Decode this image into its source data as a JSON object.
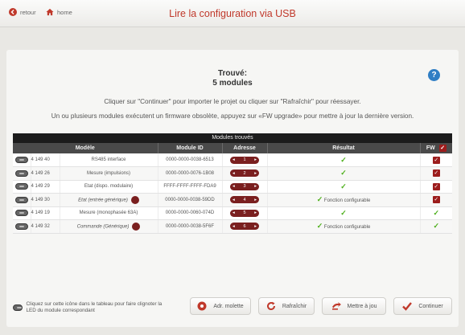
{
  "header": {
    "back_label": "retour",
    "home_label": "home",
    "title": "Lire la configuration via USB"
  },
  "summary": {
    "found_title": "Trouvé:",
    "found_count": "5 modules",
    "help_label": "?",
    "instruction": "Cliquer sur \"Continuer\" pour importer le projet ou cliquer sur \"Rafraîchir\" pour réessayer.",
    "firmware_warning": "Un ou plusieurs modules exécutent un firmware obsolète, appuyez sur «FW upgrade» pour mettre à jour la dernière version."
  },
  "table": {
    "title": "Modules trouvés",
    "headers": {
      "model": "Modèle",
      "module_id": "Module ID",
      "address": "Adresse",
      "result": "Résultat",
      "fw": "FW"
    },
    "rows": [
      {
        "code": "4 149 40",
        "name": "RS485 interface",
        "italic": false,
        "has_dot": false,
        "module_id": "0000-0000-0038-6513",
        "address": "1",
        "result": "",
        "fw": "checked"
      },
      {
        "code": "4 149 26",
        "name": "Mesure (impulsions)",
        "italic": false,
        "has_dot": false,
        "module_id": "0000-0000-0076-1B08",
        "address": "2",
        "result": "",
        "fw": "checked"
      },
      {
        "code": "4 149 29",
        "name": "Etat (dispo. modulaire)",
        "italic": false,
        "has_dot": false,
        "module_id": "FFFF-FFFF-FFFF-FDA9",
        "address": "3",
        "result": "",
        "fw": "checked"
      },
      {
        "code": "4 149 30",
        "name": "Etat (entrée générique)",
        "italic": true,
        "has_dot": true,
        "module_id": "0000-0000-0038-59DD",
        "address": "4",
        "result": "Fonction configurable",
        "fw": "checked"
      },
      {
        "code": "4 149 19",
        "name": "Mesure (monophasée 63A)",
        "italic": false,
        "has_dot": false,
        "module_id": "0000-0000-0060-074D",
        "address": "5",
        "result": "",
        "fw": "ok"
      },
      {
        "code": "4 149 32",
        "name": "Commande (Générique)",
        "italic": true,
        "has_dot": true,
        "module_id": "0000-0000-0038-5F6F",
        "address": "6",
        "result": "Fonction configurable",
        "fw": "ok"
      }
    ]
  },
  "footer": {
    "note": "Cliquez sur cette icône dans le tableau pour faire clignoter la LED du module correspondant",
    "btn_adr": "Adr. molette",
    "btn_refresh": "Rafraîchir",
    "btn_update": "Mettre à jou",
    "btn_continue": "Continuer"
  },
  "colors": {
    "accent_red": "#c0392b",
    "dark_red": "#7a1f1f",
    "ok_green": "#4caf1a",
    "help_blue": "#2f7ec4"
  }
}
